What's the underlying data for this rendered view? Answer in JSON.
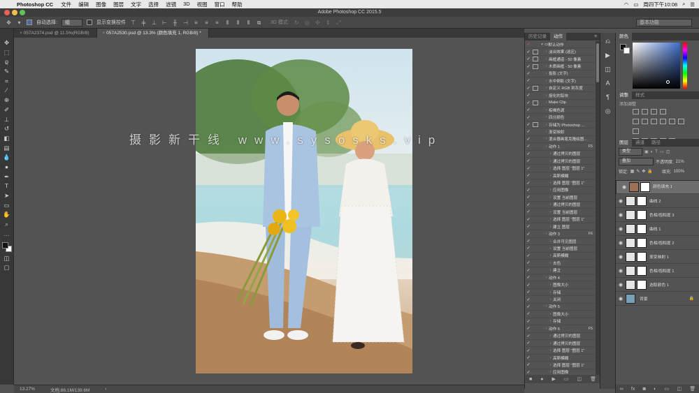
{
  "menubar": {
    "app_name": "Photoshop CC",
    "items": [
      "文件",
      "编辑",
      "图像",
      "图层",
      "文字",
      "选择",
      "滤镜",
      "3D",
      "视图",
      "窗口",
      "帮助"
    ],
    "clock": "周四下午10:08"
  },
  "window": {
    "title": "Adobe Photoshop CC 2015.5"
  },
  "options": {
    "auto_select_label": "自动选择:",
    "auto_select_value": "组",
    "transform_label": "显示变换控件",
    "mode_3d": "3D 模式:",
    "workspace": "基本功能"
  },
  "tabs": [
    {
      "label": "057A2374.psd @ 11.5%(RGB/8)",
      "active": false
    },
    {
      "label": "057A2530.psd @ 13.3% (颜色填充 1, RGB/8) *",
      "active": true
    }
  ],
  "watermark": "摄影新干线 www.sysosks.vip",
  "status": {
    "zoom": "13.27%",
    "doc": "文档:86.1M/139.6M"
  },
  "actions_panel": {
    "tabs": [
      "历史记录",
      "动作"
    ],
    "items": [
      {
        "label": "默认动作",
        "depth": 0,
        "dialog": false,
        "shortcut": ""
      },
      {
        "label": "淡出效果 (选区)",
        "depth": 1,
        "dialog": true,
        "shortcut": ""
      },
      {
        "label": "画框通道 - 50 像素",
        "depth": 1,
        "dialog": true,
        "shortcut": ""
      },
      {
        "label": "木质画框 - 50 像素",
        "depth": 1,
        "dialog": true,
        "shortcut": ""
      },
      {
        "label": "投影 (文字)",
        "depth": 1,
        "dialog": false,
        "shortcut": ""
      },
      {
        "label": "水中倒影 (文字)",
        "depth": 1,
        "dialog": false,
        "shortcut": ""
      },
      {
        "label": "自定义 RGB 到灰度",
        "depth": 1,
        "dialog": true,
        "shortcut": ""
      },
      {
        "label": "熔化的铅块",
        "depth": 1,
        "dialog": false,
        "shortcut": ""
      },
      {
        "label": "Make Clip",
        "depth": 1,
        "dialog": true,
        "shortcut": ""
      },
      {
        "label": "棕褐色调",
        "depth": 1,
        "dialog": false,
        "shortcut": ""
      },
      {
        "label": "四分颜色",
        "depth": 1,
        "dialog": false,
        "shortcut": ""
      },
      {
        "label": "存储为 Photoshop ...",
        "depth": 1,
        "dialog": true,
        "shortcut": ""
      },
      {
        "label": "渐变映射",
        "depth": 1,
        "dialog": false,
        "shortcut": ""
      },
      {
        "label": "混合器画笔克隆绘图...",
        "depth": 1,
        "dialog": false,
        "shortcut": ""
      },
      {
        "label": "动作 1",
        "depth": 1,
        "dialog": false,
        "shortcut": "F5"
      },
      {
        "label": "通过拷贝的图层",
        "depth": 2,
        "dialog": false,
        "shortcut": ""
      },
      {
        "label": "通过拷贝的图层",
        "depth": 2,
        "dialog": false,
        "shortcut": ""
      },
      {
        "label": "选择 图层 \"图层 1\"",
        "depth": 2,
        "dialog": false,
        "shortcut": ""
      },
      {
        "label": "高斯模糊",
        "depth": 2,
        "dialog": false,
        "shortcut": ""
      },
      {
        "label": "选择 图层 \"图层 1\"",
        "depth": 2,
        "dialog": false,
        "shortcut": ""
      },
      {
        "label": "应用图像",
        "depth": 2,
        "dialog": false,
        "shortcut": ""
      },
      {
        "label": "设置 当前图层",
        "depth": 2,
        "dialog": false,
        "shortcut": ""
      },
      {
        "label": "通过拷贝的图层",
        "depth": 2,
        "dialog": false,
        "shortcut": ""
      },
      {
        "label": "设置 当前图层",
        "depth": 2,
        "dialog": false,
        "shortcut": ""
      },
      {
        "label": "选择 图层 \"图层 1\"",
        "depth": 2,
        "dialog": false,
        "shortcut": ""
      },
      {
        "label": "建立 图层",
        "depth": 2,
        "dialog": false,
        "shortcut": ""
      },
      {
        "label": "动作 3",
        "depth": 1,
        "dialog": false,
        "shortcut": "F6"
      },
      {
        "label": "合并可见图层",
        "depth": 2,
        "dialog": false,
        "shortcut": ""
      },
      {
        "label": "设置 当前图层",
        "depth": 2,
        "dialog": false,
        "shortcut": ""
      },
      {
        "label": "高斯模糊",
        "depth": 2,
        "dialog": false,
        "shortcut": ""
      },
      {
        "label": "去色",
        "depth": 2,
        "dialog": false,
        "shortcut": ""
      },
      {
        "label": "建立",
        "depth": 2,
        "dialog": false,
        "shortcut": ""
      },
      {
        "label": "动作 4",
        "depth": 1,
        "dialog": false,
        "shortcut": ""
      },
      {
        "label": "图像大小",
        "depth": 2,
        "dialog": false,
        "shortcut": ""
      },
      {
        "label": "存储",
        "depth": 2,
        "dialog": false,
        "shortcut": ""
      },
      {
        "label": "关闭",
        "depth": 2,
        "dialog": false,
        "shortcut": ""
      },
      {
        "label": "动作 5",
        "depth": 1,
        "dialog": false,
        "shortcut": ""
      },
      {
        "label": "图像大小",
        "depth": 2,
        "dialog": false,
        "shortcut": ""
      },
      {
        "label": "存储",
        "depth": 2,
        "dialog": false,
        "shortcut": ""
      },
      {
        "label": "动作 6",
        "depth": 1,
        "dialog": false,
        "shortcut": "F5"
      },
      {
        "label": "通过拷贝的图层",
        "depth": 2,
        "dialog": false,
        "shortcut": ""
      },
      {
        "label": "通过拷贝的图层",
        "depth": 2,
        "dialog": false,
        "shortcut": ""
      },
      {
        "label": "选择 图层 \"图层 1\"",
        "depth": 2,
        "dialog": false,
        "shortcut": ""
      },
      {
        "label": "高斯模糊",
        "depth": 2,
        "dialog": false,
        "shortcut": ""
      },
      {
        "label": "选择 图层 \"图层 1\"",
        "depth": 2,
        "dialog": false,
        "shortcut": ""
      },
      {
        "label": "应用图像",
        "depth": 2,
        "dialog": false,
        "shortcut": ""
      }
    ]
  },
  "color_panel": {
    "title": "颜色"
  },
  "adjustments_panel": {
    "tabs": [
      "调整",
      "样式"
    ],
    "hint": "添加调整"
  },
  "layers_panel": {
    "tabs": [
      "图层",
      "通道",
      "路径"
    ],
    "kind_label": "类型",
    "blend_mode": "叠加",
    "opacity_label": "不透明度:",
    "opacity_value": "21%",
    "lock_label": "锁定:",
    "fill_label": "填充:",
    "fill_value": "100%",
    "layers": [
      {
        "name": "颜色填充 1",
        "selected": true,
        "thumb": "#9a7257",
        "lock": false
      },
      {
        "name": "曲线 2",
        "selected": false,
        "thumb": "#e6e6e6",
        "lock": false
      },
      {
        "name": "色相/饱和度 3",
        "selected": false,
        "thumb": "#e6e6e6",
        "lock": false
      },
      {
        "name": "曲线 1",
        "selected": false,
        "thumb": "#e6e6e6",
        "lock": false
      },
      {
        "name": "色相/饱和度 2",
        "selected": false,
        "thumb": "#e6e6e6",
        "lock": false
      },
      {
        "name": "渐变映射 1",
        "selected": false,
        "thumb": "#e6e6e6",
        "lock": false
      },
      {
        "name": "色相/饱和度 1",
        "selected": false,
        "thumb": "#e6e6e6",
        "lock": false
      },
      {
        "name": "选取颜色 1",
        "selected": false,
        "thumb": "#e6e6e6",
        "lock": false
      },
      {
        "name": "背景",
        "selected": false,
        "thumb": "#7aa0b8",
        "lock": true
      }
    ]
  },
  "colors": {
    "accent": "#6d6d6d",
    "fill_swatch": "#9a7257"
  }
}
